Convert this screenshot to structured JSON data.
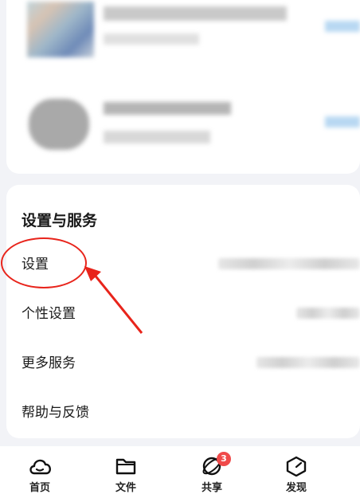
{
  "settings_section": {
    "title": "设置与服务",
    "items": [
      {
        "label": "设置"
      },
      {
        "label": "个性设置"
      },
      {
        "label": "更多服务"
      },
      {
        "label": "帮助与反馈"
      }
    ]
  },
  "tabbar": {
    "tabs": [
      {
        "label": "首页",
        "icon": "cloud-icon"
      },
      {
        "label": "文件",
        "icon": "folder-icon"
      },
      {
        "label": "共享",
        "icon": "orbit-icon",
        "badge": "3"
      },
      {
        "label": "发现",
        "icon": "cube-icon"
      }
    ]
  },
  "annotation": {
    "highlight_color": "#e8241b"
  }
}
